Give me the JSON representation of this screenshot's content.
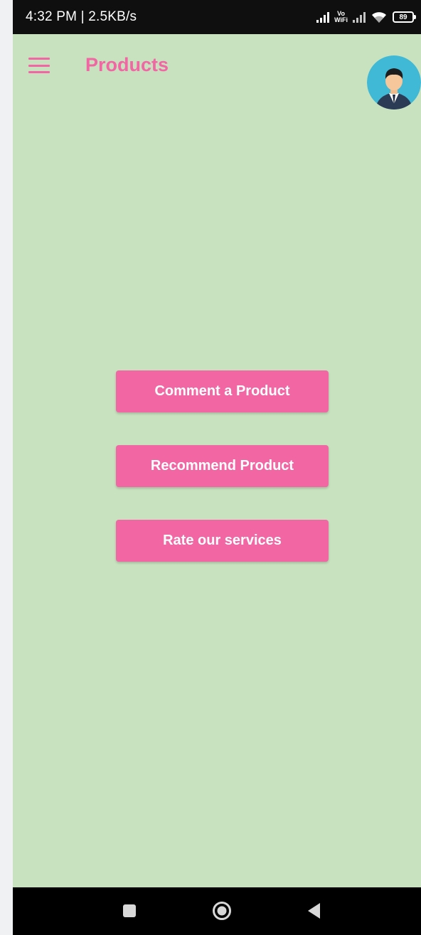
{
  "status_bar": {
    "time": "4:32 PM | 2.5KB/s",
    "vowifi_top": "Vo",
    "vowifi_bottom": "WiFi",
    "battery_level": "89",
    "icons": [
      "signal-icon",
      "vowifi-icon",
      "signal-no-sim-icon",
      "wifi-icon",
      "battery-icon"
    ]
  },
  "app_bar": {
    "title": "Products",
    "menu_icon": "hamburger-menu-icon",
    "avatar_icon": "user-avatar-icon"
  },
  "actions": [
    {
      "label": "Comment a Product"
    },
    {
      "label": "Recommend Product"
    },
    {
      "label": "Rate our services"
    }
  ],
  "nav_bar": {
    "icons": [
      "recents-square-icon",
      "home-circle-icon",
      "back-triangle-icon"
    ]
  },
  "colors": {
    "accent": "#f266a4",
    "background": "#c8e2bf",
    "status_bar": "#0f0f0f",
    "nav_bar": "#000000"
  }
}
